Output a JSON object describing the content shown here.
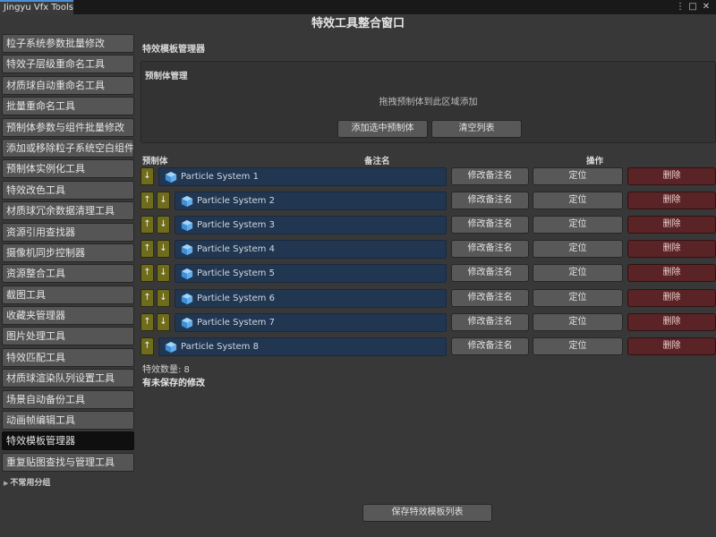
{
  "window": {
    "tab_title": "Jingyu Vfx Tools",
    "menu_icon": "kebab-menu-icon",
    "maximize_icon": "maximize-icon",
    "close_icon": "close-icon"
  },
  "page_title": "特效工具整合窗口",
  "sidebar": {
    "items": [
      {
        "label": "粒子系统参数批量修改"
      },
      {
        "label": "特效子层级重命名工具"
      },
      {
        "label": "材质球自动重命名工具"
      },
      {
        "label": "批量重命名工具"
      },
      {
        "label": "预制体参数与组件批量修改"
      },
      {
        "label": "添加或移除粒子系统空白组件"
      },
      {
        "label": "预制体实例化工具"
      },
      {
        "label": "特效改色工具"
      },
      {
        "label": "材质球冗余数据清理工具"
      },
      {
        "label": "资源引用查找器"
      },
      {
        "label": "摄像机同步控制器"
      },
      {
        "label": "资源整合工具"
      },
      {
        "label": "截图工具"
      },
      {
        "label": "收藏夹管理器"
      },
      {
        "label": "图片处理工具"
      },
      {
        "label": "特效匹配工具"
      },
      {
        "label": "材质球渲染队列设置工具"
      },
      {
        "label": "场景自动备份工具"
      },
      {
        "label": "动画帧编辑工具"
      },
      {
        "label": "特效模板管理器"
      },
      {
        "label": "重复贴图查找与管理工具"
      }
    ],
    "active_index": 19,
    "group_label": "不常用分组",
    "group_icon": "triangle-right-icon"
  },
  "main": {
    "header": "特效模板管理器",
    "prefab_box": {
      "title": "预制体管理",
      "drop_hint": "拖拽预制体到此区域添加",
      "add_button": "添加选中预制体",
      "clear_button": "清空列表"
    },
    "columns": {
      "prefab": "预制体",
      "note": "备注名",
      "actions": "操作"
    },
    "row_buttons": {
      "edit_note": "修改备注名",
      "locate": "定位",
      "delete": "删除"
    },
    "arrows": {
      "up": "↑",
      "down": "↓"
    },
    "item_icon": "cube-icon",
    "rows": [
      {
        "name": "Particle System 1",
        "up": false,
        "down": true
      },
      {
        "name": "Particle System 2",
        "up": true,
        "down": true
      },
      {
        "name": "Particle System 3",
        "up": true,
        "down": true
      },
      {
        "name": "Particle System 4",
        "up": true,
        "down": true
      },
      {
        "name": "Particle System 5",
        "up": true,
        "down": true
      },
      {
        "name": "Particle System 6",
        "up": true,
        "down": true
      },
      {
        "name": "Particle System 7",
        "up": true,
        "down": true
      },
      {
        "name": "Particle System 8",
        "up": true,
        "down": false
      }
    ],
    "count_text": "特效数量: 8",
    "unsaved_text": "有未保存的修改",
    "save_button": "保存特效模板列表"
  },
  "colors": {
    "accent": "#4b8fd6",
    "arrow_button": "#6f6c1c",
    "object_field": "#213650",
    "delete_button": "#5a2326",
    "active_sidebar": "#0f0f0f"
  }
}
